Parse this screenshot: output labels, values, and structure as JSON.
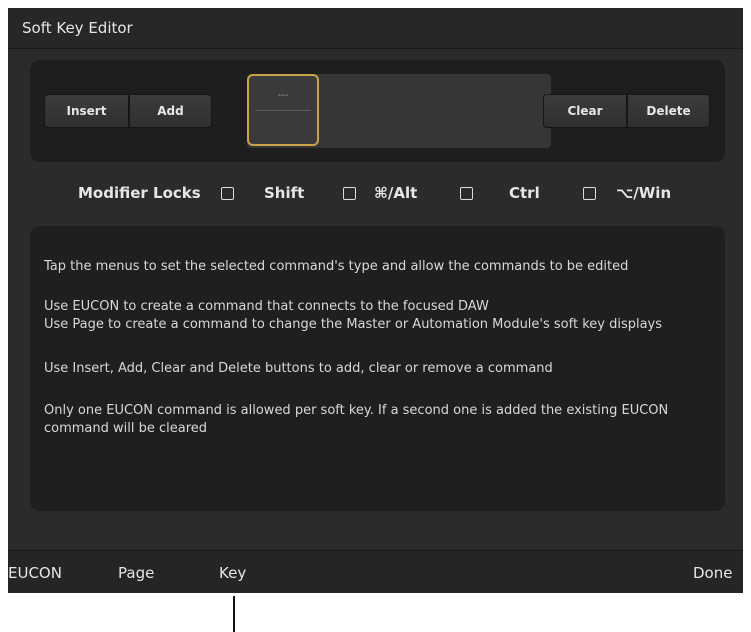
{
  "window": {
    "title": "Soft Key Editor"
  },
  "toolbar": {
    "insert_label": "Insert",
    "add_label": "Add",
    "clear_label": "Clear",
    "delete_label": "Delete"
  },
  "key_slot": {
    "placeholder": "---"
  },
  "modifiers": {
    "heading": "Modifier Locks",
    "items": [
      {
        "label": "Shift",
        "checked": false
      },
      {
        "label": "⌘/Alt",
        "checked": false
      },
      {
        "label": "Ctrl",
        "checked": false
      },
      {
        "label": "⌥/Win",
        "checked": false
      }
    ]
  },
  "info": {
    "lines": [
      "Tap the menus to set the selected command's type and allow the commands to be edited",
      "Use EUCON to create a command that connects to the focused DAW",
      "Use Page to create a command to change the Master or Automation Module's soft key displays",
      "Use Insert, Add, Clear and Delete buttons to add, clear or remove a command",
      "Only one EUCON command is allowed per soft key.  If a second one is added the existing EUCON command will be cleared"
    ]
  },
  "bottom_bar": {
    "eucon_label": "EUCON",
    "page_label": "Page",
    "key_label": "Key",
    "done_label": "Done"
  },
  "colors": {
    "selection_border": "#c9a24a",
    "background": "#2b2b2b"
  }
}
